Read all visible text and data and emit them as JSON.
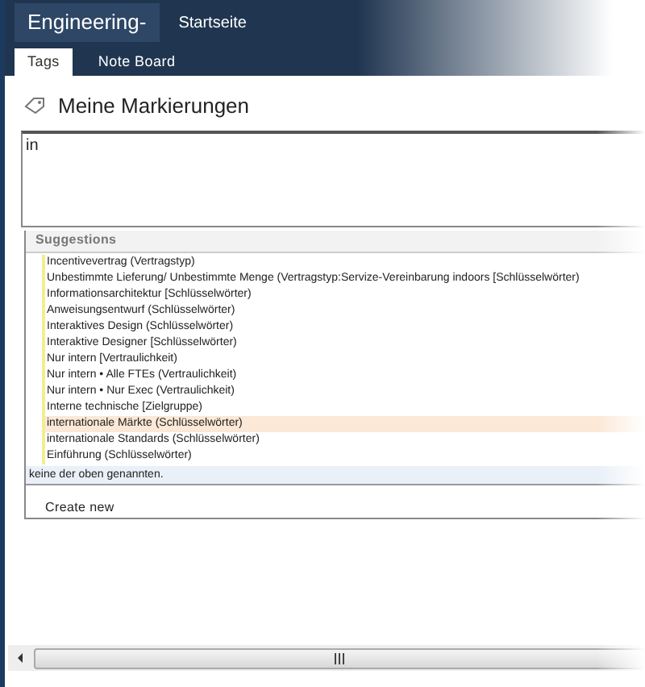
{
  "header": {
    "site_title": "Engineering-",
    "nav_link": "Startseite"
  },
  "tabs": [
    {
      "label": "Tags",
      "selected": true
    },
    {
      "label": "Note Board",
      "selected": false
    }
  ],
  "heading": "Meine Markierungen",
  "tag_input": {
    "value": "in"
  },
  "suggestions": {
    "title": "Suggestions",
    "items": [
      {
        "label": "Incentivevertrag (Vertragstyp)",
        "selected": false
      },
      {
        "label": "Unbestimmte Lieferung/ Unbestimmte Menge (Vertragstyp:Servize-Vereinbarung indoors [Schlüsselwörter)",
        "selected": false
      },
      {
        "label": "Informationsarchitektur [Schlüsselwörter)",
        "selected": false
      },
      {
        "label": "Anweisungsentwurf (Schlüsselwörter)",
        "selected": false
      },
      {
        "label": "Interaktives Design (Schlüsselwörter)",
        "selected": false
      },
      {
        "label": "Interaktive Designer [Schlüsselwörter)",
        "selected": false
      },
      {
        "label": "Nur intern [Vertraulichkeit)",
        "selected": false
      },
      {
        "label": "Nur intern • Alle FTEs (Vertraulichkeit)",
        "selected": false
      },
      {
        "label": "Nur intern • Nur Exec (Vertraulichkeit)",
        "selected": false
      },
      {
        "label": "Interne technische [Zielgruppe)",
        "selected": false
      },
      {
        "label": "internationale Märkte (Schlüsselwörter)",
        "selected": true
      },
      {
        "label": "internationale Standards (Schlüsselwörter)",
        "selected": false
      },
      {
        "label": "Einführung (Schlüsselwörter)",
        "selected": false
      }
    ],
    "none_option": "keine der oben genannten.",
    "create_new": "Create new"
  }
}
